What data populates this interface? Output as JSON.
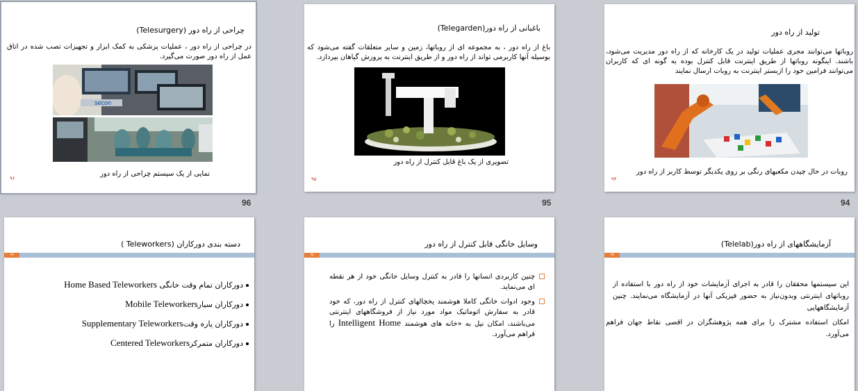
{
  "slides": {
    "s96": {
      "number": "96",
      "title": "چراحی از راه دور (Telesurgery)",
      "body": "در چراحی از راه دور ، عملیات پزشکی به کمک ابزار و تجهیزات تصب شده در اتاق عمل از راه دور صورت می‌گیرد.",
      "caption": "نمایی از یک سیستم چراحی از راه دور",
      "page": "۹۶"
    },
    "s95": {
      "number": "95",
      "title": "باغبانی از راه دور(Telegarden)",
      "body": "باغ از راه دور ، به مجموعه ای از روباتها، زمین و سایر متعلقات گفته می‌شود که بوسیله آنها کاربرمی تواند از راه دور و از طریق اینترنت به پرورش گیاهان بپردازد.",
      "caption": "تصویری از یک باغ قابل کنترل از راه دور",
      "page": "۹۵"
    },
    "s94": {
      "number": "94",
      "title": "تولید از راه دور",
      "body": "روباتها می‌توانند مجری عملیات تولید در یک کارخانه که از راه دور مدیریت می‌شود، باشند. اینگونه روباتها از طریق اینترنت قابل کنترل بوده به گونه ای که کاربران می‌توانند فرامین خود را ازبستر اینترنت به روبات ارسال نمایند",
      "caption": "روبات در حال چیدن مکعبهای رنگی بر روی یکدیگر توسط کاربر از راه دور",
      "page": "۹۴"
    },
    "s99": {
      "title": "دسته بندی دورکاران  (Teleworkers )",
      "tab": "۹۹",
      "items": [
        {
          "fa": "دورکاران تمام وقت خانگی",
          "en": "Home Based Teleworkers"
        },
        {
          "fa": "دورکاران سیار",
          "en": "Mobile  Teleworkers"
        },
        {
          "fa": "دورکاران پاره وقت",
          "en": "Supplementary Teleworkers"
        },
        {
          "fa": "دورکاران متمرکز",
          "en": "Centered  Teleworkers"
        }
      ]
    },
    "s98": {
      "title": "وسایل خانگی قابل کنترل از راه دور",
      "tab": "۹۸",
      "p1": "چنین کاربردی انسانها را قادر به کنترل وسایل خانگی خود از هر نقطه ای می‌نماید.",
      "p2": "وجود ادوات خانگی کاملا هوشمند یخچالهای کنترل از راه دور، که خود قادر به سفارش اتوماتیک مواد  مورد نیاز از فروشگاههای اینترنتی  می‌باشند، امکان نیل به «خانه های هوشمند",
      "p2_en1": "Intelligent",
      "p2_en2": "Home",
      "p2_tail": " را فراهم می‌آورد."
    },
    "s97": {
      "title": "آزمایشگاههای از راه دور(Telelab)",
      "tab": "۹۷",
      "body": "این سیستمها  محققان را قادر به اجرای آزمایشات خود از راه دور با استفاده از روباتهای اینترنتی  وبدون‌نیاز به حضور فیزیکی آنها در آزمایشگاه می‌نمایند. چنین آزمایشگاههایی",
      "body2": "امکان استفاده مشترک را برای همه پژوهشگران در اقصی نقاط جهان فراهم می‌آورد."
    }
  }
}
